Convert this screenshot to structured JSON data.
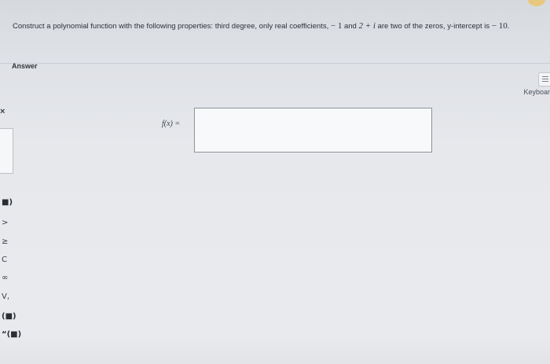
{
  "question": {
    "text_a": "Construct a polynomial function with the following properties: third degree, only real coefficients,",
    "zero_1": "− 1",
    "and": "and",
    "zero_2": "2 + i",
    "text_b": "are two of the zeros, y-intercept is",
    "intercept": "− 10",
    "end": "."
  },
  "answer": {
    "label": "Answer",
    "function_label": "f(x) =",
    "input_value": ""
  },
  "keyboard": {
    "label": "Keyboar",
    "icon": "keyboard-icon"
  },
  "left_rail": {
    "close": "×",
    "buttons": [
      {
        "label": "■)",
        "icon": "parenthesis-icon"
      },
      {
        "label": ">",
        "icon": "greater-than-icon"
      },
      {
        "label": "≥",
        "icon": "greater-equal-icon"
      },
      {
        "label": "C",
        "icon": "complement-icon"
      },
      {
        "label": "∞",
        "icon": "infinity-icon"
      },
      {
        "label": "V,",
        "icon": "union-icon"
      },
      {
        "label": "(■)",
        "icon": "interval-icon"
      },
      {
        "label": "“(■)",
        "icon": "bracket-interval-icon"
      }
    ]
  },
  "colors": {
    "background": "#e6e8ec",
    "question_bar": "#d9dce1",
    "input_border": "#8e939b",
    "text": "#2d3138"
  }
}
